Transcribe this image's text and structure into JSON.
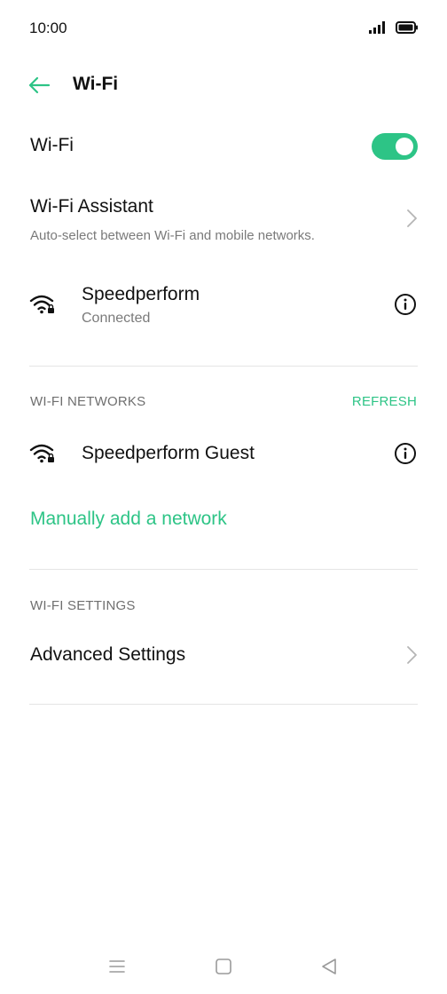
{
  "status_bar": {
    "time": "10:00",
    "signal_icon": "signal-icon",
    "battery_icon": "battery-icon"
  },
  "header": {
    "back_icon": "arrow-left-icon",
    "title": "Wi-Fi"
  },
  "wifi_toggle": {
    "label": "Wi-Fi",
    "enabled": true
  },
  "wifi_assistant": {
    "title": "Wi-Fi Assistant",
    "subtitle": "Auto-select between Wi-Fi and mobile networks."
  },
  "connected_network": {
    "name": "Speedperform",
    "status": "Connected",
    "icon": "wifi-locked-icon",
    "info_icon": "info-icon"
  },
  "networks_section": {
    "label": "WI-FI NETWORKS",
    "refresh_label": "REFRESH",
    "items": [
      {
        "name": "Speedperform Guest",
        "icon": "wifi-locked-icon",
        "info_icon": "info-icon"
      }
    ],
    "manual_add_label": "Manually add a network"
  },
  "settings_section": {
    "label": "WI-FI SETTINGS",
    "advanced_label": "Advanced Settings"
  },
  "colors": {
    "accent": "#2dc486",
    "text": "#111111",
    "subtext": "#7a7a7a",
    "divider": "#e4e4e4"
  },
  "nav_bar": {
    "menu_icon": "menu-icon",
    "home_icon": "home-icon",
    "back_icon": "back-triangle-icon"
  }
}
